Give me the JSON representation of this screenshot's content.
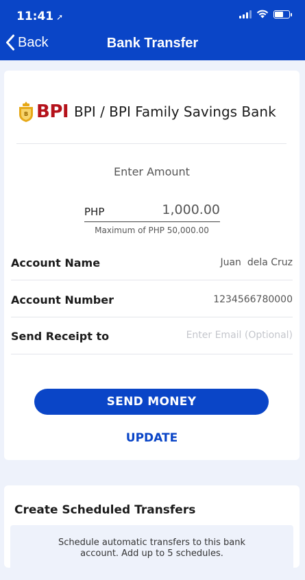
{
  "status_bar": {
    "time": "11:41",
    "location_glyph": "➚"
  },
  "nav": {
    "back_label": "Back",
    "title": "Bank Transfer"
  },
  "bank": {
    "logo_text": "BPI",
    "name": "BPI / BPI Family Savings Bank"
  },
  "amount": {
    "label": "Enter Amount",
    "currency": "PHP",
    "value": "1,000.00",
    "max_note": "Maximum of PHP 50,000.00"
  },
  "fields": {
    "account_name": {
      "label": "Account Name",
      "value": "Juan  dela Cruz"
    },
    "account_number": {
      "label": "Account Number",
      "value": "1234566780000"
    },
    "receipt": {
      "label": "Send Receipt to",
      "placeholder": "Enter Email (Optional)"
    }
  },
  "actions": {
    "send_label": "SEND MONEY",
    "update_label": "UPDATE"
  },
  "scheduled": {
    "title": "Create Scheduled Transfers",
    "description": "Schedule automatic transfers to this bank account. Add up to 5 schedules."
  },
  "colors": {
    "primary": "#0a45c7",
    "bpi_red": "#b5121b",
    "bpi_gold": "#e6a817",
    "background": "#eef2fb"
  }
}
